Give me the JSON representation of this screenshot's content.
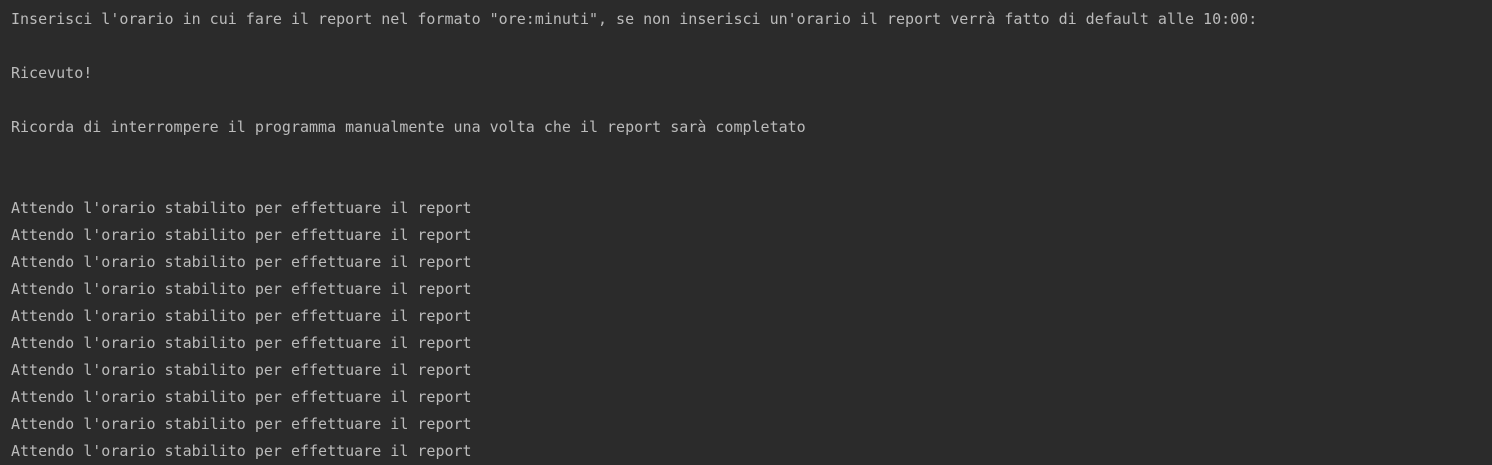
{
  "console": {
    "prompt": "Inserisci l'orario in cui fare il report nel formato \"ore:minuti\", se non inserisci un'orario il report verrà fatto di default alle 10:00:",
    "received": "Ricevuto!",
    "reminder": "Ricorda di interrompere il programma manualmente una volta che il report sarà completato",
    "waiting": [
      "Attendo l'orario stabilito per effettuare il report",
      "Attendo l'orario stabilito per effettuare il report",
      "Attendo l'orario stabilito per effettuare il report",
      "Attendo l'orario stabilito per effettuare il report",
      "Attendo l'orario stabilito per effettuare il report",
      "Attendo l'orario stabilito per effettuare il report",
      "Attendo l'orario stabilito per effettuare il report",
      "Attendo l'orario stabilito per effettuare il report",
      "Attendo l'orario stabilito per effettuare il report",
      "Attendo l'orario stabilito per effettuare il report"
    ],
    "colors": {
      "background": "#2b2b2b",
      "text": "#bbbbbb"
    }
  }
}
